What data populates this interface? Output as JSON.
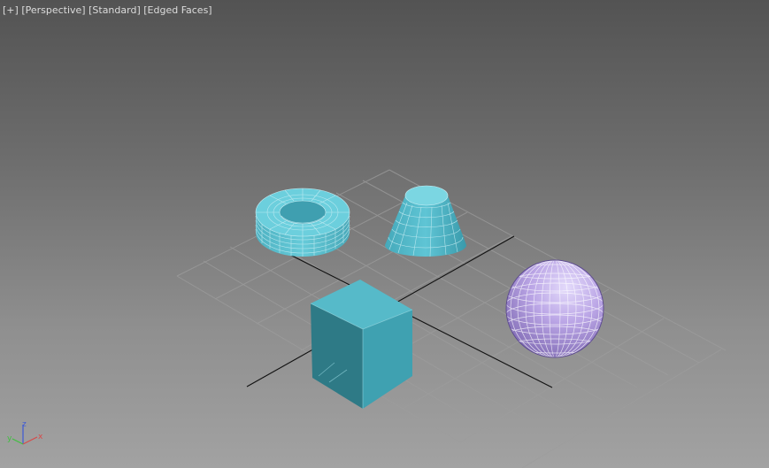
{
  "viewport": {
    "labels": {
      "menu": "[+]",
      "view": "[Perspective]",
      "shading": "[Standard]",
      "mode": "[Edged Faces]"
    }
  },
  "axis_gizmo": {
    "x": "x",
    "y": "y",
    "z": "z"
  },
  "colors": {
    "object_cyan": "#55b8c8",
    "object_cyan_dark": "#2f7f8c",
    "selected_sphere": "#b6a0e2",
    "grid_line": "#9a9a9a",
    "axis_line": "#111111"
  },
  "objects": [
    {
      "name": "torus",
      "type": "primitive"
    },
    {
      "name": "cone",
      "type": "primitive"
    },
    {
      "name": "box",
      "type": "primitive"
    },
    {
      "name": "sphere",
      "type": "primitive",
      "selected": true
    }
  ]
}
